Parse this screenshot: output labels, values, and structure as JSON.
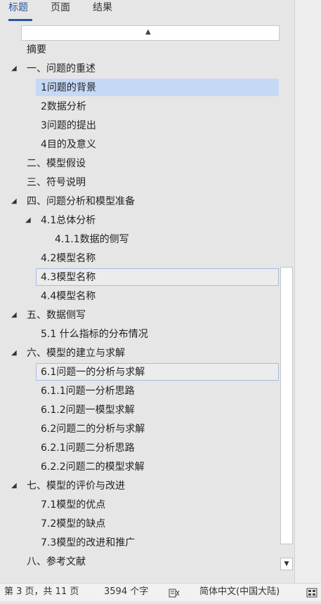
{
  "tabs": [
    {
      "label": "标题"
    },
    {
      "label": "页面"
    },
    {
      "label": "结果"
    }
  ],
  "search": {
    "up_glyph": "▲"
  },
  "tree": {
    "items": [
      {
        "label": "摘要"
      },
      {
        "label": "一、问题的重述",
        "toggle": "◢"
      },
      {
        "label": "1问题的背景"
      },
      {
        "label": "2数据分析"
      },
      {
        "label": "3问题的提出"
      },
      {
        "label": "4目的及意义"
      },
      {
        "label": "二、模型假设"
      },
      {
        "label": "三、符号说明"
      },
      {
        "label": "四、问题分析和模型准备",
        "toggle": "◢"
      },
      {
        "label": "4.1总体分析",
        "toggle": "◢"
      },
      {
        "label": "4.1.1数据的侧写"
      },
      {
        "label": "4.2模型名称"
      },
      {
        "label": "4.3模型名称"
      },
      {
        "label": "4.4模型名称"
      },
      {
        "label": "五、数据侧写",
        "toggle": "◢"
      },
      {
        "label": "5.1 什么指标的分布情况"
      },
      {
        "label": "六、模型的建立与求解",
        "toggle": "◢"
      },
      {
        "label": "6.1问题一的分析与求解"
      },
      {
        "label": "6.1.1问题一分析思路"
      },
      {
        "label": "6.1.2问题一模型求解"
      },
      {
        "label": "6.2问题二的分析与求解"
      },
      {
        "label": "6.2.1问题二分析思路"
      },
      {
        "label": "6.2.2问题二的模型求解"
      },
      {
        "label": "七、模型的评价与改进",
        "toggle": "◢"
      },
      {
        "label": "7.1模型的优点"
      },
      {
        "label": "7.2模型的缺点"
      },
      {
        "label": "7.3模型的改进和推广"
      },
      {
        "label": "八、参考文献"
      }
    ]
  },
  "scrollbar": {
    "down_glyph": "▼"
  },
  "status": {
    "page": "第 3 页，共 11 页",
    "words": "3594 个字",
    "language": "简体中文(中国大陆)"
  },
  "colors": {
    "accent": "#2b579a",
    "selection": "#c5d9f7",
    "outline": "#a7bde4"
  }
}
